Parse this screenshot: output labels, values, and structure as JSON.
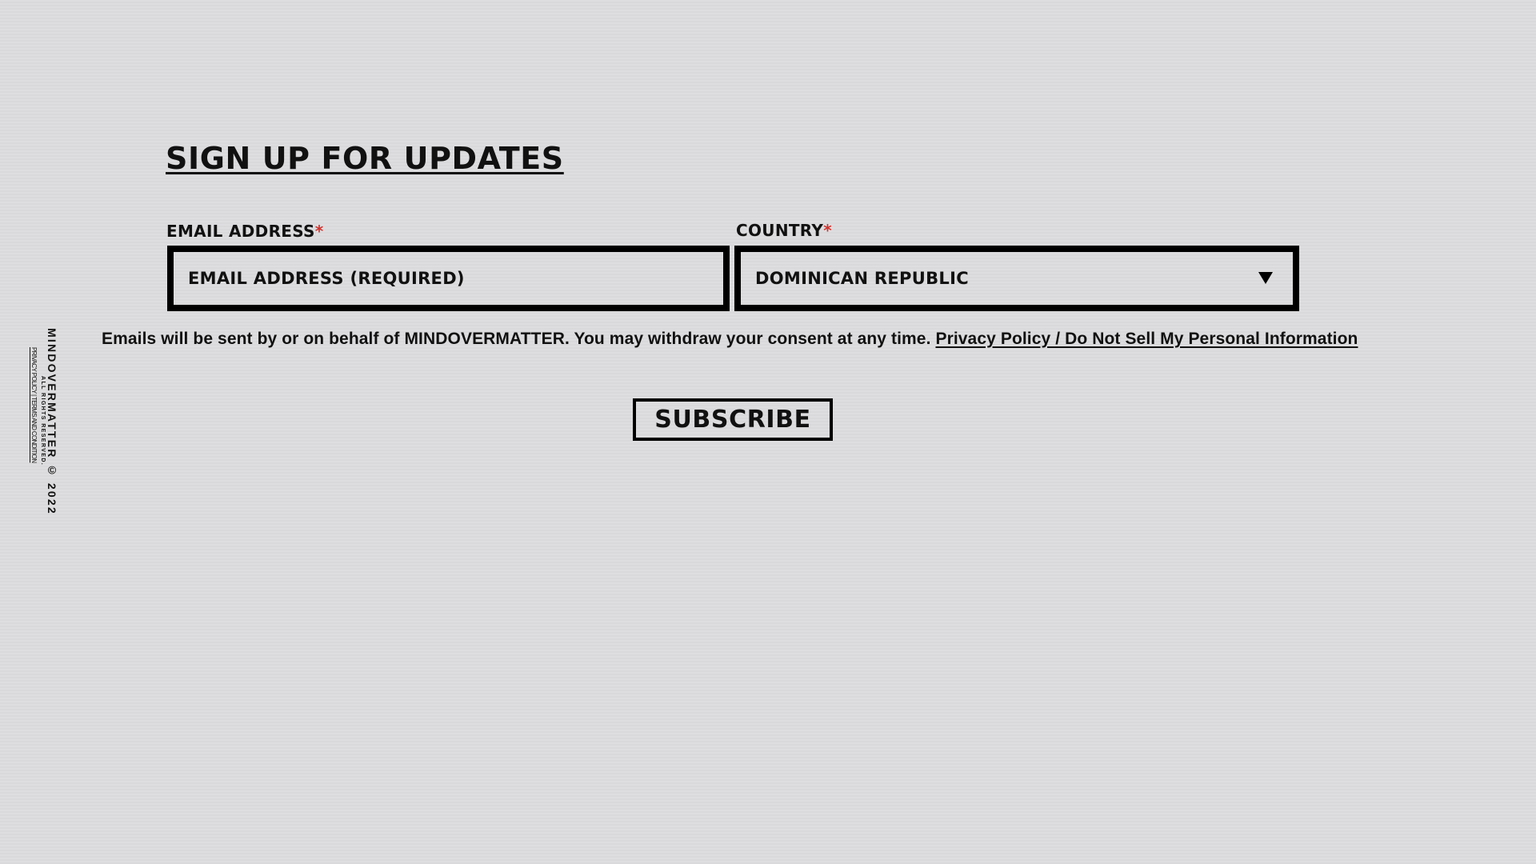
{
  "footer": {
    "brand_copyright": "MINDOVERMATTER © 2022",
    "rights": "ALL RIGHTS RESERVED.",
    "links": "PRIVACY POLICY | TERMS AND CONDITION"
  },
  "form": {
    "heading": "SIGN UP FOR UPDATES",
    "email": {
      "label": "EMAIL ADDRESS",
      "required_mark": "*",
      "placeholder": "EMAIL ADDRESS (REQUIRED)",
      "value": ""
    },
    "country": {
      "label": "COUNTRY",
      "required_mark": "*",
      "selected": "DOMINICAN REPUBLIC",
      "icon": "triangle-down-icon"
    },
    "consent": {
      "text": "Emails will be sent by or on behalf of MINDOVERMATTER. You may withdraw your consent at any time.",
      "link_text": "Privacy Policy / Do Not Sell My Personal Information"
    },
    "subscribe_label": "SUBSCRIBE"
  },
  "colors": {
    "background": "#dcdcde",
    "text": "#111111",
    "border": "#000000",
    "required": "#d0332e"
  }
}
